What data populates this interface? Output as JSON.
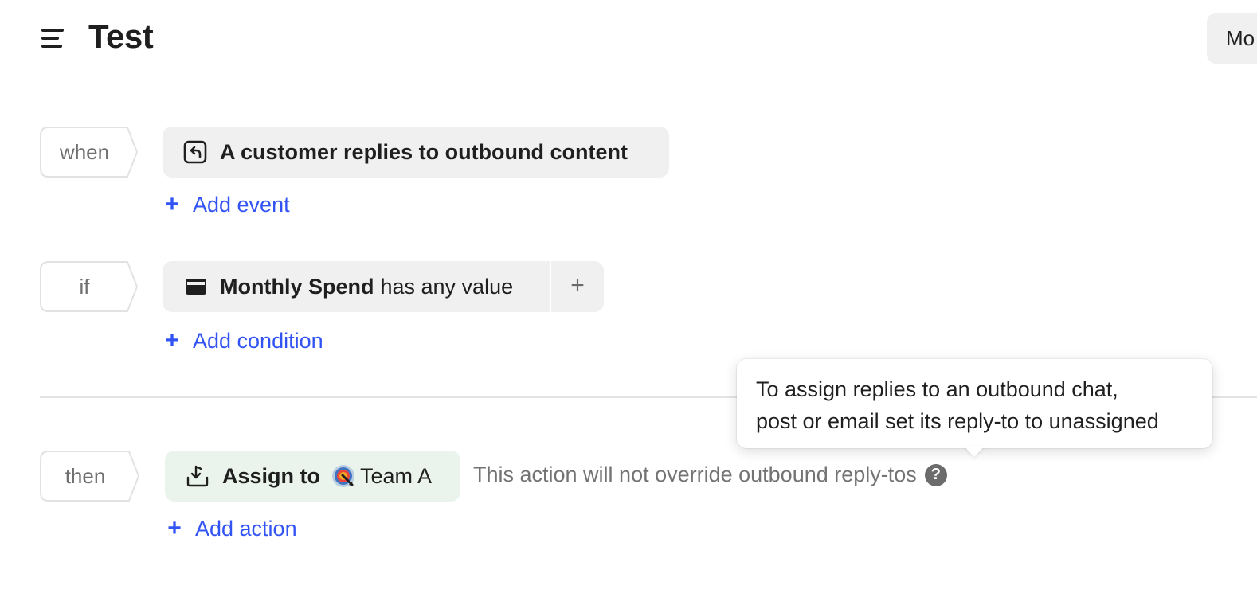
{
  "header": {
    "title": "Test",
    "more_button_label": "Mo"
  },
  "when": {
    "keyword": "when",
    "event_label": "A customer replies to outbound content",
    "event_icon": "reply-icon",
    "add_label": "Add event"
  },
  "if": {
    "keyword": "if",
    "condition": {
      "attribute": "Monthly Spend",
      "operator": "has any value",
      "icon": "credit-card-icon"
    },
    "add_inline_label": "+",
    "add_label": "Add condition"
  },
  "then": {
    "keyword": "then",
    "action": {
      "verb": "Assign to",
      "team": "Team A",
      "icon": "assign-inbox-icon",
      "team_icon": "target-icon"
    },
    "note": "This action will not override outbound reply-tos",
    "help_glyph": "?",
    "add_label": "Add action"
  },
  "tooltip": {
    "line1": "To assign replies to an outbound chat,",
    "line2": "post or email set its reply-to to unassigned"
  },
  "add_glyph": "+",
  "colors": {
    "accent": "#3354f4",
    "pill_grey": "#f0f0f0",
    "pill_green": "#eaf4ec",
    "muted_text": "#737373"
  }
}
